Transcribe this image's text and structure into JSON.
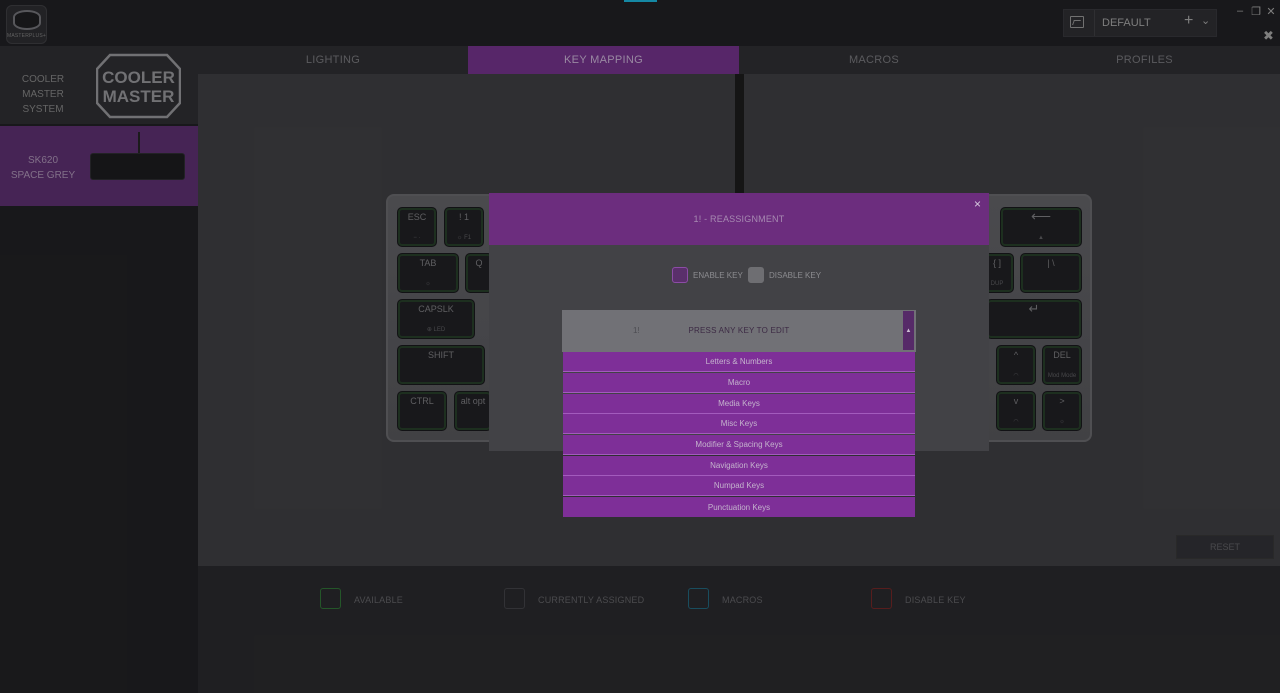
{
  "app": {
    "logo_text": "MASTERPLUS+"
  },
  "profile": {
    "name": "DEFAULT",
    "add_symbol": "+",
    "chevron": "⌄"
  },
  "window": {
    "minimize": "–",
    "restore": "❐",
    "close": "✕",
    "tools": "✖"
  },
  "sidebar": {
    "devices": [
      {
        "label_line1": "COOLER MASTER",
        "label_line2": "SYSTEM",
        "logo_line1": "COOLER",
        "logo_line2": "MASTER"
      },
      {
        "label_line1": "SK620",
        "label_line2": "SPACE GREY"
      }
    ]
  },
  "tabs": [
    {
      "label": "LIGHTING"
    },
    {
      "label": "KEY MAPPING",
      "active": true
    },
    {
      "label": "MACROS"
    },
    {
      "label": "PROFILES"
    }
  ],
  "keyboard": {
    "keys": {
      "esc": "ESC",
      "esc_sub": "− ·",
      "one": "! 1",
      "one_sub": "☼ F1",
      "tab": "TAB",
      "tab_sub": "☼",
      "q": "Q",
      "capslk": "CAPSLK",
      "capslk_sub": "⊕ LED",
      "shift": "SHIFT",
      "ctrl": "CTRL",
      "alt": "alt opt",
      "backspace": "⟵",
      "backspace_sub": "▲",
      "bracket": "{ ]",
      "bracket_sub": "DUP",
      "backslash": "| \\",
      "enter": "↵",
      "up": "^",
      "up_sub": "◠",
      "del": "DEL",
      "del_sub": "Mod Mode",
      "down": "v",
      "down_sub": "◠",
      "right": ">",
      "right_sub": "☼"
    }
  },
  "legend": [
    {
      "label": "AVAILABLE",
      "color": "#2c6a32"
    },
    {
      "label": "CURRENTLY ASSIGNED",
      "color": "#3e3e42"
    },
    {
      "label": "MACROS",
      "color": "#1f5f73"
    },
    {
      "label": "DISABLE KEY",
      "color": "#6b2424"
    }
  ],
  "reset_label": "RESET",
  "modal": {
    "title": "1!    - REASSIGNMENT",
    "close": "×",
    "enable_label": "ENABLE KEY",
    "disable_label": "DISABLE KEY",
    "dropdown": {
      "key": "1!",
      "prompt": "PRESS ANY KEY TO EDIT",
      "arrow": "▲",
      "items": [
        "Letters & Numbers",
        "Macro",
        "Media Keys",
        "Misc Keys",
        "Modifier & Spacing Keys",
        "Navigation Keys",
        "Numpad Keys",
        "Punctuation Keys"
      ]
    }
  }
}
